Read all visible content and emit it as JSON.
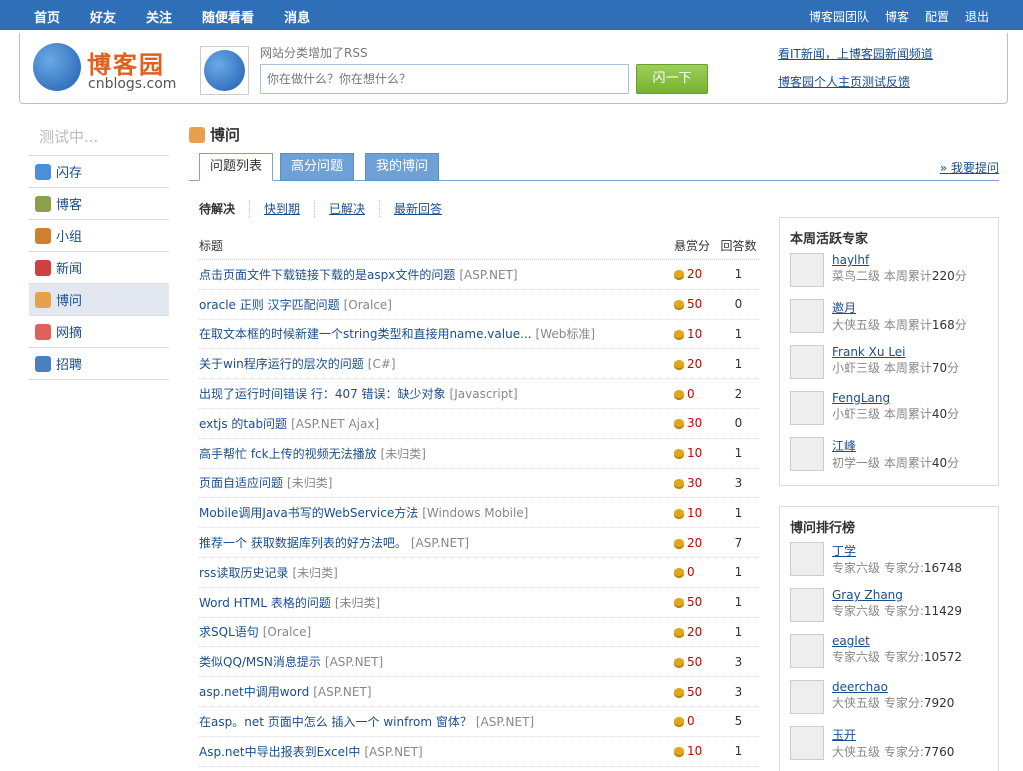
{
  "topnav": {
    "left": [
      "首页",
      "好友",
      "关注",
      "随便看看",
      "消息"
    ],
    "right": [
      "博客园团队",
      "博客",
      "配置",
      "退出"
    ]
  },
  "header": {
    "brand": "博客园",
    "domain": "cnblogs.com",
    "status_label": "网站分类增加了RSS",
    "status_placeholder": "你在做什么？你在想什么？",
    "flash_button": "闪一下",
    "links": [
      "看IT新闻，上博客园新闻频道",
      "博客园个人主页测试反馈"
    ]
  },
  "sidebar": {
    "title": "测试中...",
    "items": [
      {
        "label": "闪存",
        "color": "#4a90d9"
      },
      {
        "label": "博客",
        "color": "#8aa04c"
      },
      {
        "label": "小组",
        "color": "#d08030"
      },
      {
        "label": "新闻",
        "color": "#d04040"
      },
      {
        "label": "博问",
        "color": "#e8a04c",
        "active": true
      },
      {
        "label": "网摘",
        "color": "#e06060"
      },
      {
        "label": "招聘",
        "color": "#4a80c0"
      }
    ]
  },
  "main": {
    "title": "博问",
    "tabs": [
      "问题列表",
      "高分问题",
      "我的博问"
    ],
    "ask_link": "» 我要提问",
    "filters": [
      "待解决",
      "快到期",
      "已解决",
      "最新回答"
    ],
    "columns": {
      "title": "标题",
      "reward": "悬赏分",
      "answers": "回答数"
    },
    "questions": [
      {
        "title": "点击页面文件下载链接下载的是aspx文件的问题",
        "cat": "[ASP.NET]",
        "reward": "20",
        "answers": "1"
      },
      {
        "title": "oracle 正则 汉字匹配问题",
        "cat": "[Oralce]",
        "reward": "50",
        "answers": "0"
      },
      {
        "title": "在取文本框的时候新建一个string类型和直接用name.value...",
        "cat": "[Web标准]",
        "reward": "10",
        "answers": "1"
      },
      {
        "title": "关于win程序运行的层次的问题",
        "cat": "[C#]",
        "reward": "20",
        "answers": "1"
      },
      {
        "title": "出现了运行时间错误 行：407 错误：缺少对象",
        "cat": "[Javascript]",
        "reward": "0",
        "answers": "2"
      },
      {
        "title": "extjs 的tab问题",
        "cat": "[ASP.NET Ajax]",
        "reward": "30",
        "answers": "0"
      },
      {
        "title": "高手帮忙 fck上传的视频无法播放",
        "cat": "[未归类]",
        "reward": "10",
        "answers": "1"
      },
      {
        "title": "页面自适应问题",
        "cat": "[未归类]",
        "reward": "30",
        "answers": "3"
      },
      {
        "title": "Mobile调用Java书写的WebService方法",
        "cat": "[Windows Mobile]",
        "reward": "10",
        "answers": "1"
      },
      {
        "title": "推荐一个 获取数据库列表的好方法吧。",
        "cat": "[ASP.NET]",
        "reward": "20",
        "answers": "7"
      },
      {
        "title": "rss读取历史记录",
        "cat": "[未归类]",
        "reward": "0",
        "answers": "1"
      },
      {
        "title": "Word HTML 表格的问题",
        "cat": "[未归类]",
        "reward": "50",
        "answers": "1"
      },
      {
        "title": "求SQL语句",
        "cat": "[Oralce]",
        "reward": "20",
        "answers": "1"
      },
      {
        "title": "类似QQ/MSN消息提示",
        "cat": "[ASP.NET]",
        "reward": "50",
        "answers": "3"
      },
      {
        "title": "asp.net中调用word",
        "cat": "[ASP.NET]",
        "reward": "50",
        "answers": "3"
      },
      {
        "title": "在asp。net 页面中怎么 插入一个 winfrom 窗体？",
        "cat": "[ASP.NET]",
        "reward": "0",
        "answers": "5"
      },
      {
        "title": "Asp.net中导出报表到Excel中",
        "cat": "[ASP.NET]",
        "reward": "10",
        "answers": "1"
      }
    ]
  },
  "experts": {
    "title": "本周活跃专家",
    "people": [
      {
        "name": "haylhf",
        "level": "菜鸟二级",
        "label": "本周累计",
        "score": "220",
        "unit": "分"
      },
      {
        "name": "邀月",
        "level": "大侠五级",
        "label": "本周累计",
        "score": "168",
        "unit": "分"
      },
      {
        "name": "Frank Xu Lei",
        "level": "小虾三级",
        "label": "本周累计",
        "score": "70",
        "unit": "分"
      },
      {
        "name": "FengLang",
        "level": "小虾三级",
        "label": "本周累计",
        "score": "40",
        "unit": "分"
      },
      {
        "name": "江峰",
        "level": "初学一级",
        "label": "本周累计",
        "score": "40",
        "unit": "分"
      }
    ]
  },
  "ranking": {
    "title": "博问排行榜",
    "people": [
      {
        "name": "丁学",
        "level": "专家六级",
        "label": "专家分:",
        "score": "16748"
      },
      {
        "name": "Gray Zhang",
        "level": "专家六级",
        "label": "专家分:",
        "score": "11429"
      },
      {
        "name": "eaglet",
        "level": "专家六级",
        "label": "专家分:",
        "score": "10572"
      },
      {
        "name": "deerchao",
        "level": "大侠五级",
        "label": "专家分:",
        "score": "7920"
      },
      {
        "name": "玉开",
        "level": "大侠五级",
        "label": "专家分:",
        "score": "7760"
      }
    ]
  }
}
